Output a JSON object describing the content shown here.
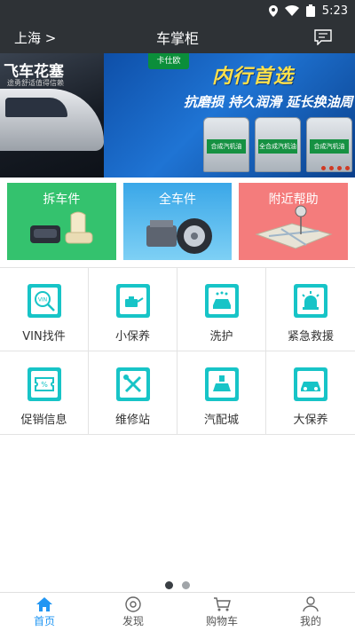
{
  "status_bar": {
    "time": "5:23"
  },
  "header": {
    "city": "上海 >",
    "title": "车掌柜",
    "message_icon": "message-icon"
  },
  "banner": {
    "left_title": "飞车花塞",
    "left_sub": "途勇舒适值得信赖",
    "brand": "卡仕欧",
    "slogan_main": "内行首选",
    "slogan_sub": "抗磨损 持久润滑 延长换油周",
    "bottle_labels": [
      "合成汽机油",
      "全合成汽机油",
      "合成汽机油"
    ],
    "dot_color": "#cf3a24"
  },
  "promos": [
    {
      "label": "拆车件",
      "color": "#34c26e"
    },
    {
      "label": "全车件",
      "color": "#3aa7e8"
    },
    {
      "label": "附近帮助",
      "color": "#f47c7c"
    }
  ],
  "grid": [
    {
      "label": "VIN找件",
      "icon": "vin-search-icon"
    },
    {
      "label": "小保养",
      "icon": "oil-can-icon"
    },
    {
      "label": "洗护",
      "icon": "car-wash-icon"
    },
    {
      "label": "紧急救援",
      "icon": "alarm-light-icon"
    },
    {
      "label": "促销信息",
      "icon": "discount-ticket-icon"
    },
    {
      "label": "维修站",
      "icon": "wrench-screwdriver-icon"
    },
    {
      "label": "汽配城",
      "icon": "auto-parts-icon"
    },
    {
      "label": "大保养",
      "icon": "car-service-icon"
    }
  ],
  "pager": {
    "active_color": "#3a3f44",
    "inactive_color": "#a0a4a8"
  },
  "tabs": [
    {
      "label": "首页",
      "icon": "home-icon",
      "active": true
    },
    {
      "label": "发现",
      "icon": "discover-icon",
      "active": false
    },
    {
      "label": "购物车",
      "icon": "cart-icon",
      "active": false
    },
    {
      "label": "我的",
      "icon": "profile-icon",
      "active": false
    }
  ],
  "colors": {
    "accent": "#2196f3",
    "tile": "#17c4c7",
    "header_bg": "#2e3236"
  }
}
